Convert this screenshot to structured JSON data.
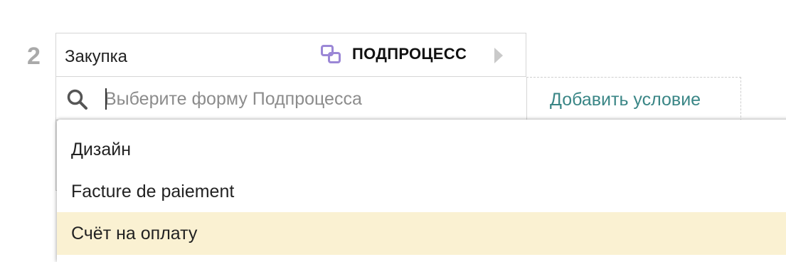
{
  "step": {
    "number": "2",
    "title": "Закупка",
    "type_label": "ПОДПРОЦЕСС",
    "type_icon": "subprocess-icon",
    "icon_color": "#9b87d6"
  },
  "search": {
    "placeholder": "Выберите форму Подпроцесса",
    "value": ""
  },
  "add_condition_label": "Добавить условие",
  "dropdown": {
    "options": [
      {
        "label": "Дизайн",
        "highlighted": false
      },
      {
        "label": "Facture de paiement",
        "highlighted": false
      },
      {
        "label": "Счёт на оплату",
        "highlighted": true
      }
    ],
    "highlight_color": "#faf1d2"
  },
  "colors": {
    "accent": "#3a8686",
    "step_number": "#a9a9a9"
  }
}
